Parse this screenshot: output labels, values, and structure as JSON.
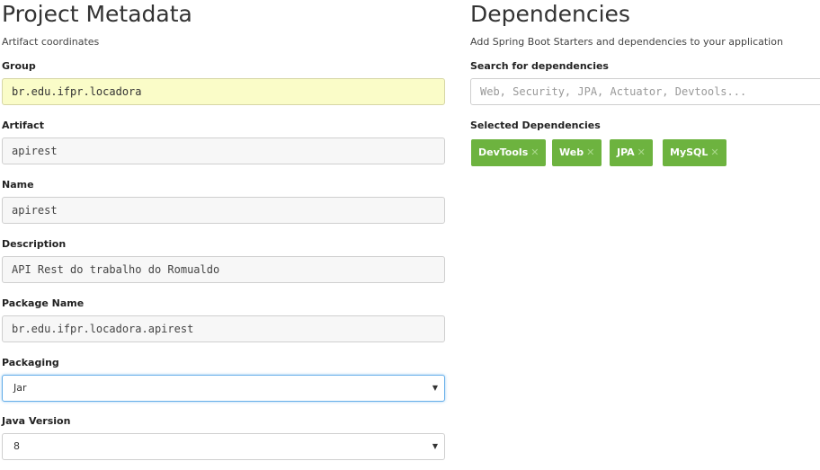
{
  "left": {
    "title": "Project Metadata",
    "subtitle": "Artifact coordinates",
    "fields": {
      "group": {
        "label": "Group",
        "value": "br.edu.ifpr.locadora"
      },
      "artifact": {
        "label": "Artifact",
        "value": "apirest"
      },
      "name": {
        "label": "Name",
        "value": "apirest"
      },
      "description": {
        "label": "Description",
        "value": "API Rest do trabalho do Romualdo"
      },
      "package_name": {
        "label": "Package Name",
        "value": "br.edu.ifpr.locadora.apirest"
      }
    },
    "packaging": {
      "label": "Packaging",
      "selected": "Jar"
    },
    "java_version": {
      "label": "Java Version",
      "selected": "8"
    }
  },
  "right": {
    "title": "Dependencies",
    "subtitle": "Add Spring Boot Starters and dependencies to your application",
    "search_label": "Search for dependencies",
    "search_placeholder": "Web, Security, JPA, Actuator, Devtools...",
    "selected_label": "Selected Dependencies",
    "selected": [
      {
        "name": "DevTools",
        "remove": "✕"
      },
      {
        "name": "Web",
        "remove": "✕"
      },
      {
        "name": "JPA",
        "remove": "✕"
      },
      {
        "name": "MySQL",
        "remove": "✕"
      }
    ]
  },
  "colors": {
    "chip": "#6db33f",
    "active_field": "#fafcc8",
    "focus_border": "#66afe9"
  },
  "icons": {
    "select_caret": "▼"
  }
}
